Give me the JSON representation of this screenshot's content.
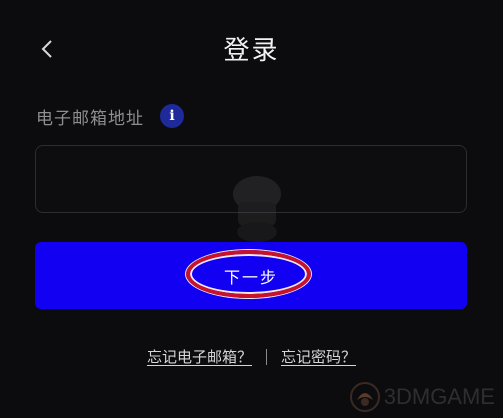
{
  "header": {
    "back_icon": "chevron-left-icon",
    "title": "登录"
  },
  "form": {
    "email_label": "电子邮箱地址",
    "info_icon": "info-icon",
    "info_glyph": "i",
    "email_value": "",
    "next_label": "下一步"
  },
  "links": {
    "forgot_email": "忘记电子邮箱？",
    "forgot_password": "忘记密码？"
  },
  "watermark": {
    "text": "3DMGAME"
  },
  "colors": {
    "background": "#0c0c0e",
    "primary_button": "#1200f2",
    "info_badge": "#1e2a9a",
    "highlight_ring": "#c8122a"
  }
}
